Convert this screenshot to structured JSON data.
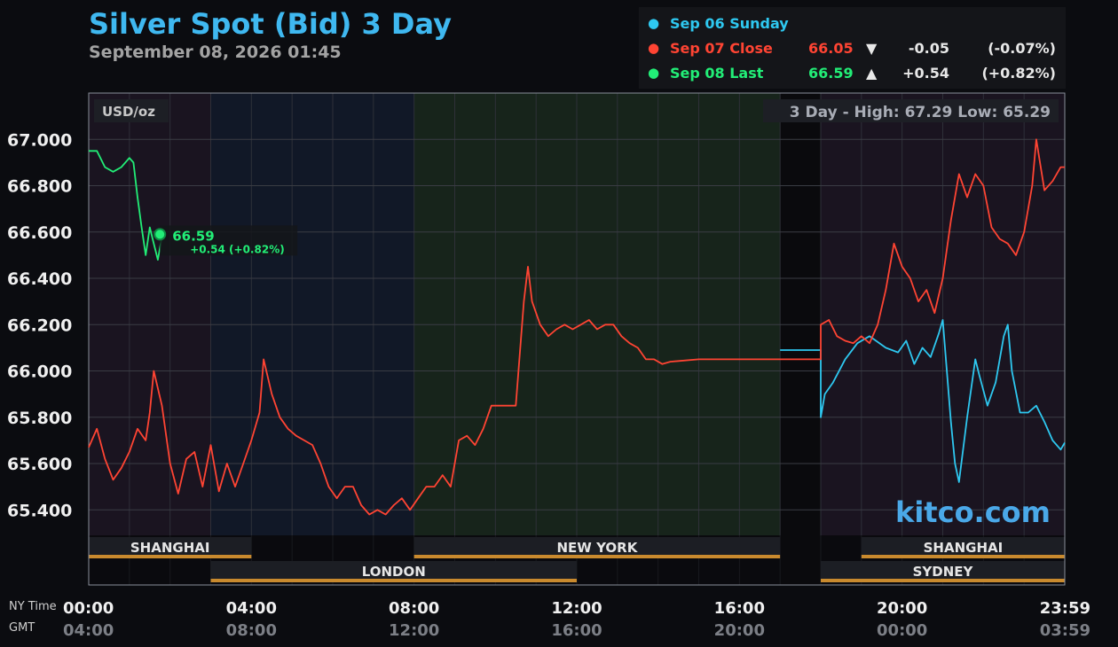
{
  "header": {
    "title": "Silver Spot (Bid) 3 Day",
    "subtitle": "September 08, 2026 01:45"
  },
  "legend": [
    {
      "name": "Sep 06 Sunday",
      "color": "#2ec8f0",
      "value": "",
      "arrow": "",
      "change": "",
      "pct": ""
    },
    {
      "name": "Sep 07 Close",
      "color": "#ff4433",
      "value": "66.05",
      "arrow": "▼",
      "change": "-0.05",
      "pct": "(-0.07%)"
    },
    {
      "name": "Sep 08 Last",
      "color": "#22ee77",
      "value": "66.59",
      "arrow": "▲",
      "change": "+0.54",
      "pct": "(+0.82%)"
    }
  ],
  "chart_data": {
    "type": "line",
    "unit_label": "USD/oz",
    "high_low_text": "3 Day - High: 67.29  Low: 65.29",
    "watermark": "kitco.com",
    "ylim": [
      65.29,
      67.2
    ],
    "y_ticks": [
      "65.400",
      "65.600",
      "65.800",
      "66.000",
      "66.200",
      "66.400",
      "66.600",
      "66.800",
      "67.000"
    ],
    "x_range_hours": [
      0,
      24
    ],
    "x_ticks_ny": [
      {
        "h": 0,
        "label": "00:00"
      },
      {
        "h": 4,
        "label": "04:00"
      },
      {
        "h": 8,
        "label": "08:00"
      },
      {
        "h": 12,
        "label": "12:00"
      },
      {
        "h": 16,
        "label": "16:00"
      },
      {
        "h": 20,
        "label": "20:00"
      },
      {
        "h": 24,
        "label": "23:59"
      }
    ],
    "x_ticks_gmt": [
      {
        "h": 0,
        "label": "04:00"
      },
      {
        "h": 4,
        "label": "08:00"
      },
      {
        "h": 8,
        "label": "12:00"
      },
      {
        "h": 12,
        "label": "16:00"
      },
      {
        "h": 16,
        "label": "20:00"
      },
      {
        "h": 20,
        "label": "00:00"
      },
      {
        "h": 24,
        "label": "03:59"
      }
    ],
    "row_labels": {
      "ny": "NY Time",
      "gmt": "GMT"
    },
    "sessions": [
      {
        "name": "SHANGHAI",
        "start": 0,
        "end": 4,
        "row": 1
      },
      {
        "name": "LONDON",
        "start": 3,
        "end": 12,
        "row": 2
      },
      {
        "name": "NEW YORK",
        "start": 8,
        "end": 17,
        "row": 1
      },
      {
        "name": "SHANGHAI",
        "start": 19,
        "end": 24,
        "row": 1
      },
      {
        "name": "SYDNEY",
        "start": 18,
        "end": 24,
        "row": 2
      }
    ],
    "series": [
      {
        "name": "Sep 06 Sunday",
        "color": "#2ec8f0",
        "points": [
          [
            17,
            66.09
          ],
          [
            18,
            66.09
          ],
          [
            18,
            65.8
          ],
          [
            18.1,
            65.9
          ],
          [
            18.3,
            65.95
          ],
          [
            18.6,
            66.05
          ],
          [
            18.9,
            66.12
          ],
          [
            19.2,
            66.15
          ],
          [
            19.6,
            66.1
          ],
          [
            19.9,
            66.08
          ],
          [
            20.1,
            66.13
          ],
          [
            20.3,
            66.03
          ],
          [
            20.5,
            66.1
          ],
          [
            20.7,
            66.06
          ],
          [
            20.9,
            66.16
          ],
          [
            21,
            66.22
          ],
          [
            21.1,
            66.0
          ],
          [
            21.2,
            65.78
          ],
          [
            21.3,
            65.6
          ],
          [
            21.4,
            65.52
          ],
          [
            21.6,
            65.8
          ],
          [
            21.8,
            66.05
          ],
          [
            21.9,
            65.98
          ],
          [
            22.1,
            65.85
          ],
          [
            22.3,
            65.95
          ],
          [
            22.5,
            66.15
          ],
          [
            22.6,
            66.2
          ],
          [
            22.7,
            66.0
          ],
          [
            22.9,
            65.82
          ],
          [
            23.1,
            65.82
          ],
          [
            23.3,
            65.85
          ],
          [
            23.5,
            65.78
          ],
          [
            23.7,
            65.7
          ],
          [
            23.9,
            65.66
          ],
          [
            24,
            65.69
          ]
        ]
      },
      {
        "name": "Sep 07 Close",
        "color": "#ff4433",
        "points": [
          [
            0,
            65.67
          ],
          [
            0.2,
            65.75
          ],
          [
            0.4,
            65.62
          ],
          [
            0.6,
            65.53
          ],
          [
            0.8,
            65.58
          ],
          [
            1,
            65.65
          ],
          [
            1.2,
            65.75
          ],
          [
            1.4,
            65.7
          ],
          [
            1.5,
            65.82
          ],
          [
            1.6,
            66.0
          ],
          [
            1.8,
            65.85
          ],
          [
            2,
            65.6
          ],
          [
            2.2,
            65.47
          ],
          [
            2.4,
            65.62
          ],
          [
            2.6,
            65.65
          ],
          [
            2.8,
            65.5
          ],
          [
            3,
            65.68
          ],
          [
            3.2,
            65.48
          ],
          [
            3.4,
            65.6
          ],
          [
            3.6,
            65.5
          ],
          [
            3.8,
            65.6
          ],
          [
            4,
            65.7
          ],
          [
            4.2,
            65.82
          ],
          [
            4.3,
            66.05
          ],
          [
            4.5,
            65.9
          ],
          [
            4.7,
            65.8
          ],
          [
            4.9,
            65.75
          ],
          [
            5.1,
            65.72
          ],
          [
            5.3,
            65.7
          ],
          [
            5.5,
            65.68
          ],
          [
            5.7,
            65.6
          ],
          [
            5.9,
            65.5
          ],
          [
            6.1,
            65.45
          ],
          [
            6.3,
            65.5
          ],
          [
            6.5,
            65.5
          ],
          [
            6.7,
            65.42
          ],
          [
            6.9,
            65.38
          ],
          [
            7.1,
            65.4
          ],
          [
            7.3,
            65.38
          ],
          [
            7.5,
            65.42
          ],
          [
            7.7,
            65.45
          ],
          [
            7.9,
            65.4
          ],
          [
            8.1,
            65.45
          ],
          [
            8.3,
            65.5
          ],
          [
            8.5,
            65.5
          ],
          [
            8.7,
            65.55
          ],
          [
            8.9,
            65.5
          ],
          [
            9.1,
            65.7
          ],
          [
            9.3,
            65.72
          ],
          [
            9.5,
            65.68
          ],
          [
            9.7,
            65.75
          ],
          [
            9.9,
            65.85
          ],
          [
            10.1,
            65.85
          ],
          [
            10.3,
            65.85
          ],
          [
            10.5,
            65.85
          ],
          [
            10.7,
            66.3
          ],
          [
            10.8,
            66.45
          ],
          [
            10.9,
            66.3
          ],
          [
            11.1,
            66.2
          ],
          [
            11.3,
            66.15
          ],
          [
            11.5,
            66.18
          ],
          [
            11.7,
            66.2
          ],
          [
            11.9,
            66.18
          ],
          [
            12.1,
            66.2
          ],
          [
            12.3,
            66.22
          ],
          [
            12.5,
            66.18
          ],
          [
            12.7,
            66.2
          ],
          [
            12.9,
            66.2
          ],
          [
            13.1,
            66.15
          ],
          [
            13.3,
            66.12
          ],
          [
            13.5,
            66.1
          ],
          [
            13.7,
            66.05
          ],
          [
            13.9,
            66.05
          ],
          [
            14.1,
            66.03
          ],
          [
            14.3,
            66.04
          ],
          [
            15,
            66.05
          ],
          [
            16,
            66.05
          ],
          [
            17,
            66.05
          ],
          [
            18,
            66.05
          ],
          [
            18,
            66.2
          ],
          [
            18.2,
            66.22
          ],
          [
            18.4,
            66.15
          ],
          [
            18.6,
            66.13
          ],
          [
            18.8,
            66.12
          ],
          [
            19,
            66.15
          ],
          [
            19.2,
            66.12
          ],
          [
            19.4,
            66.2
          ],
          [
            19.6,
            66.35
          ],
          [
            19.8,
            66.55
          ],
          [
            20,
            66.45
          ],
          [
            20.2,
            66.4
          ],
          [
            20.4,
            66.3
          ],
          [
            20.6,
            66.35
          ],
          [
            20.8,
            66.25
          ],
          [
            21,
            66.4
          ],
          [
            21.2,
            66.65
          ],
          [
            21.4,
            66.85
          ],
          [
            21.6,
            66.75
          ],
          [
            21.8,
            66.85
          ],
          [
            22,
            66.8
          ],
          [
            22.2,
            66.62
          ],
          [
            22.4,
            66.57
          ],
          [
            22.6,
            66.55
          ],
          [
            22.8,
            66.5
          ],
          [
            23,
            66.6
          ],
          [
            23.2,
            66.8
          ],
          [
            23.3,
            67.0
          ],
          [
            23.5,
            66.78
          ],
          [
            23.7,
            66.82
          ],
          [
            23.9,
            66.88
          ],
          [
            24,
            66.88
          ]
        ]
      },
      {
        "name": "Sep 08 Last",
        "color": "#22ee77",
        "points": [
          [
            0,
            66.95
          ],
          [
            0.2,
            66.95
          ],
          [
            0.4,
            66.88
          ],
          [
            0.6,
            66.86
          ],
          [
            0.8,
            66.88
          ],
          [
            1,
            66.92
          ],
          [
            1.1,
            66.9
          ],
          [
            1.2,
            66.75
          ],
          [
            1.3,
            66.62
          ],
          [
            1.4,
            66.5
          ],
          [
            1.5,
            66.62
          ],
          [
            1.6,
            66.55
          ],
          [
            1.7,
            66.48
          ],
          [
            1.8,
            66.58
          ],
          [
            1.75,
            66.59
          ]
        ]
      }
    ],
    "callout": {
      "value": "66.59",
      "change": "+0.54 (+0.82%)"
    }
  }
}
